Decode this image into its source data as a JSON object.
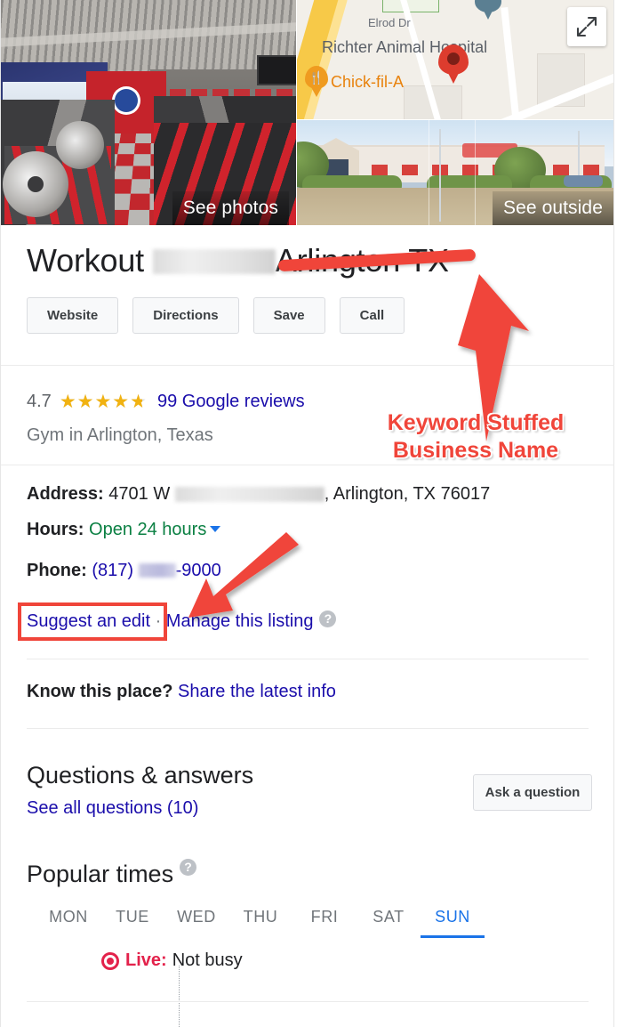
{
  "media": {
    "photo_caption": "See photos",
    "street_caption": "See outside",
    "map": {
      "labels": [
        "Elrod Dr",
        "Richter Animal Hospital"
      ],
      "poi": "Chick-fil-A",
      "expand_icon": "expand-icon",
      "pin_icon": "map-pin-icon"
    }
  },
  "business": {
    "title_prefix": "Workout",
    "title_suffix": "Arlington TX",
    "rating_value": "4.7",
    "rating_fill_percent": 94,
    "reviews_label": "99 Google reviews",
    "category": "Gym in Arlington, Texas"
  },
  "actions": {
    "website": "Website",
    "directions": "Directions",
    "save": "Save",
    "call": "Call"
  },
  "details": {
    "address_label": "Address:",
    "address_prefix": "4701 W",
    "address_suffix": ", Arlington, TX 76017",
    "hours_label": "Hours:",
    "hours_value": "Open 24 hours",
    "phone_label": "Phone:",
    "phone_prefix": "(817)",
    "phone_suffix": "-9000",
    "suggest_edit": "Suggest an edit",
    "separator": "·",
    "manage_listing": "Manage this listing",
    "help_icon": "help-icon"
  },
  "know_place": {
    "prompt": "Know this place?",
    "link": "Share the latest info"
  },
  "qa": {
    "heading": "Questions & answers",
    "see_all": "See all questions (10)",
    "ask_button": "Ask a question"
  },
  "popular_times": {
    "heading": "Popular times",
    "help_icon": "help-icon",
    "days": [
      "MON",
      "TUE",
      "WED",
      "THU",
      "FRI",
      "SAT",
      "SUN"
    ],
    "active_day": "SUN",
    "live_label": "Live:",
    "live_value": "Not busy",
    "live_icon": "live-dot-icon"
  },
  "annotations": {
    "callout_line1": "Keyword Stuffed",
    "callout_line2": "Business Name",
    "accent_color": "#f0453a"
  },
  "colors": {
    "link": "#1a0dab",
    "star": "#f1b211",
    "open": "#0b8043",
    "tab_active": "#1a73e8",
    "live": "#e3224b"
  }
}
